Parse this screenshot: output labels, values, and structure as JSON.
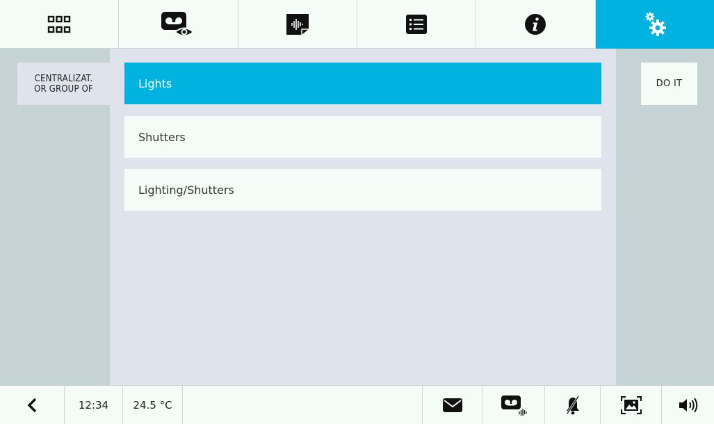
{
  "tabs": [
    {
      "icon": "grid-icon",
      "active": false
    },
    {
      "icon": "video-message-watch-icon",
      "active": false
    },
    {
      "icon": "audio-memo-icon",
      "active": false
    },
    {
      "icon": "list-icon",
      "active": false
    },
    {
      "icon": "info-icon",
      "active": false
    },
    {
      "icon": "settings-gears-icon",
      "active": true
    }
  ],
  "left_panel": {
    "centralization_line1": "CENTRALIZAT.",
    "centralization_line2": "OR GROUP OF"
  },
  "options": [
    {
      "label": "Lights",
      "selected": true
    },
    {
      "label": "Shutters",
      "selected": false
    },
    {
      "label": "Lighting/Shutters",
      "selected": false
    }
  ],
  "right_panel": {
    "do_it_label": "DO IT"
  },
  "status_bar": {
    "back_icon": "back-chevron-icon",
    "time": "12:34",
    "temperature": "24.5 °C",
    "icons": [
      "envelope-icon",
      "videomessage-icon",
      "doorbell-muted-icon",
      "photo-frame-icon",
      "speaker-volume-icon"
    ]
  },
  "colors": {
    "accent": "#00b2e0",
    "side_panel": "#c5d3d4",
    "content_bg": "#dfe4ec",
    "row_bg": "#f5fbf6"
  }
}
